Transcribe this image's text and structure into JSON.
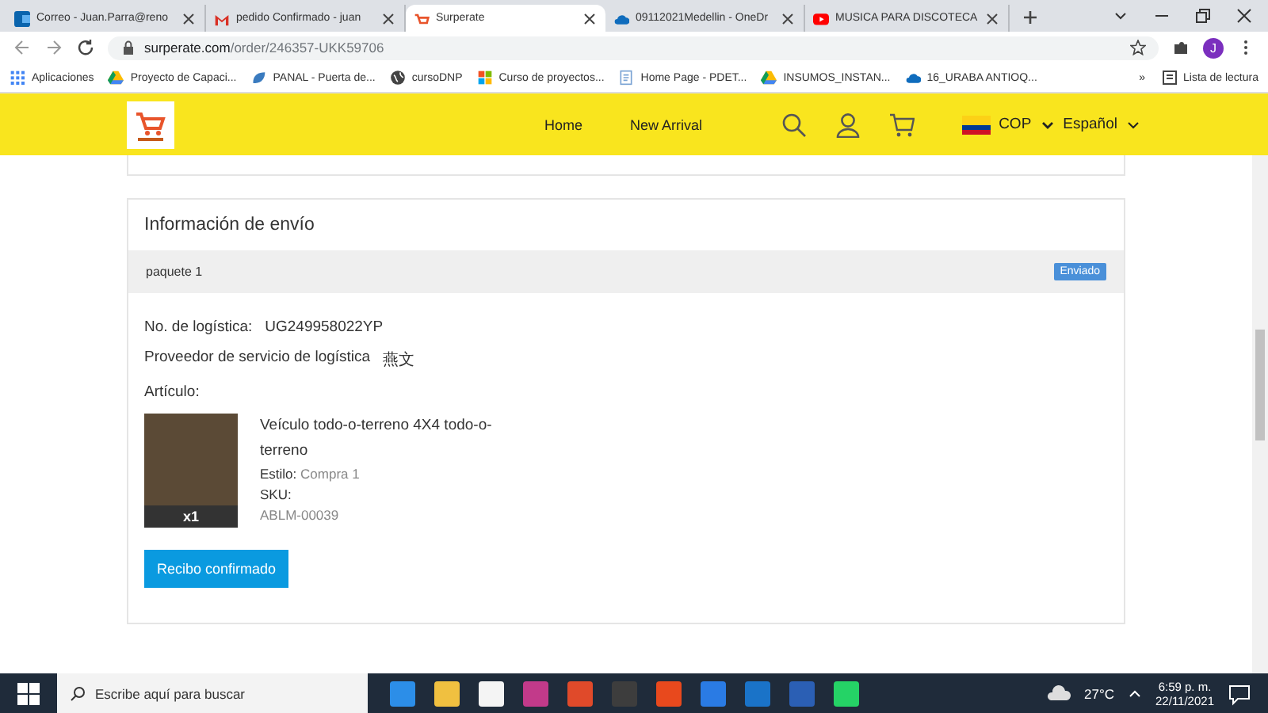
{
  "browser": {
    "tabs": [
      {
        "title": "Correo - Juan.Parra@reno",
        "kind": "mail",
        "selected": false
      },
      {
        "title": "pedido Confirmado - juan",
        "kind": "gmail",
        "selected": false
      },
      {
        "title": "Surperate",
        "kind": "store",
        "selected": true
      },
      {
        "title": "09112021Medellin - OneDr",
        "kind": "cloud",
        "selected": false
      },
      {
        "title": "MUSICA PARA DISCOTECA",
        "kind": "video",
        "selected": false
      }
    ],
    "url_host": "surperate.com",
    "url_path": "/order/246357-UKK59706",
    "bookmarks": [
      {
        "label": "Aplicaciones",
        "kind": "apps"
      },
      {
        "label": "Proyecto de Capaci...",
        "kind": "drive"
      },
      {
        "label": "PANAL - Puerta de...",
        "kind": "leaf"
      },
      {
        "label": "cursoDNP",
        "kind": "globe"
      },
      {
        "label": "Curso de proyectos...",
        "kind": "tiles"
      },
      {
        "label": "Home Page - PDET...",
        "kind": "page"
      },
      {
        "label": "INSUMOS_INSTAN...",
        "kind": "drive"
      },
      {
        "label": "16_URABA ANTIOQ...",
        "kind": "cloud"
      }
    ],
    "more": "»",
    "reading_list": "Lista de lectura",
    "profile": "J"
  },
  "store": {
    "nav": [
      "Home",
      "New Arrival"
    ],
    "currency": "COP",
    "language": "Español"
  },
  "shipping": {
    "title": "Información de envío",
    "package": {
      "label": "paquete 1",
      "status": "Enviado"
    },
    "tracking": {
      "label": "No. de logística:",
      "value": "UG249958022YP"
    },
    "provider": {
      "label": "Proveedor de servicio de logística",
      "value": "燕文"
    },
    "article_label": "Artículo:",
    "item": {
      "name": "Veículo todo-o-terreno 4X4 todo-o-terreno",
      "style_label": "Estilo:",
      "style_value": "Compra 1",
      "sku_label": "SKU:",
      "sku_value": "ABLM-00039",
      "quantity": "x1"
    },
    "button": "Recibo confirmado"
  },
  "taskbar": {
    "search_placeholder": "Escribe aquí para buscar",
    "temperature": "27°C",
    "time": "6:59 p. m.",
    "date": "22/11/2021"
  }
}
